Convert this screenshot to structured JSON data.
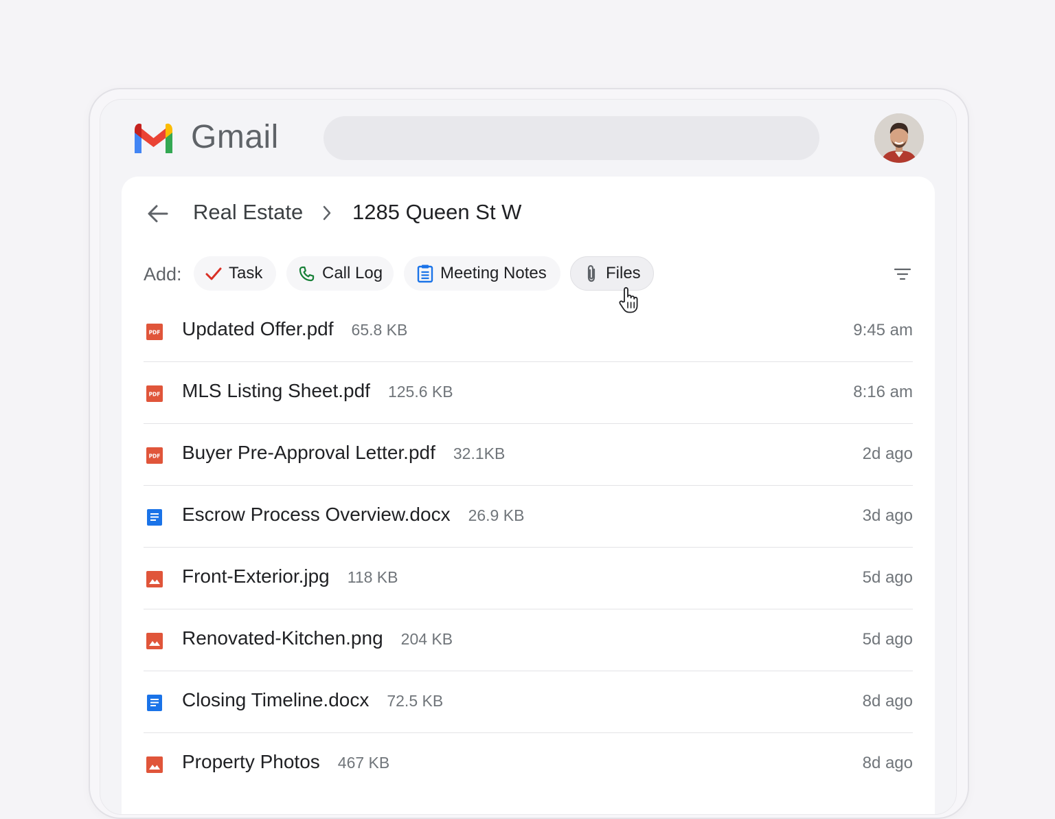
{
  "app": {
    "title": "Gmail"
  },
  "search": {
    "placeholder": ""
  },
  "breadcrumb": {
    "parent": "Real Estate",
    "current": "1285 Queen St W"
  },
  "add_bar": {
    "label": "Add:",
    "chips": [
      {
        "label": "Task",
        "icon": "check-icon"
      },
      {
        "label": "Call Log",
        "icon": "phone-icon"
      },
      {
        "label": "Meeting Notes",
        "icon": "clipboard-icon"
      },
      {
        "label": "Files",
        "icon": "paperclip-icon"
      }
    ]
  },
  "files": [
    {
      "name": "Updated Offer.pdf",
      "size": "65.8 KB",
      "time": "9:45 am",
      "type": "pdf"
    },
    {
      "name": "MLS Listing Sheet.pdf",
      "size": "125.6 KB",
      "time": "8:16 am",
      "type": "pdf"
    },
    {
      "name": "Buyer Pre-Approval Letter.pdf",
      "size": "32.1KB",
      "time": "2d ago",
      "type": "pdf"
    },
    {
      "name": "Escrow Process Overview.docx",
      "size": "26.9 KB",
      "time": "3d ago",
      "type": "doc"
    },
    {
      "name": "Front-Exterior.jpg",
      "size": "118 KB",
      "time": "5d ago",
      "type": "image"
    },
    {
      "name": "Renovated-Kitchen.png",
      "size": "204 KB",
      "time": "5d ago",
      "type": "image"
    },
    {
      "name": "Closing Timeline.docx",
      "size": "72.5 KB",
      "time": "8d ago",
      "type": "doc"
    },
    {
      "name": "Property Photos",
      "size": "467 KB",
      "time": "8d ago",
      "type": "image"
    }
  ],
  "icons": {
    "pdf_badge": "PDF"
  },
  "colors": {
    "pdf": "#e0553a",
    "doc": "#1a73e8",
    "image": "#e0553a",
    "check": "#d93025",
    "phone": "#188038",
    "clipboard": "#1a73e8"
  }
}
